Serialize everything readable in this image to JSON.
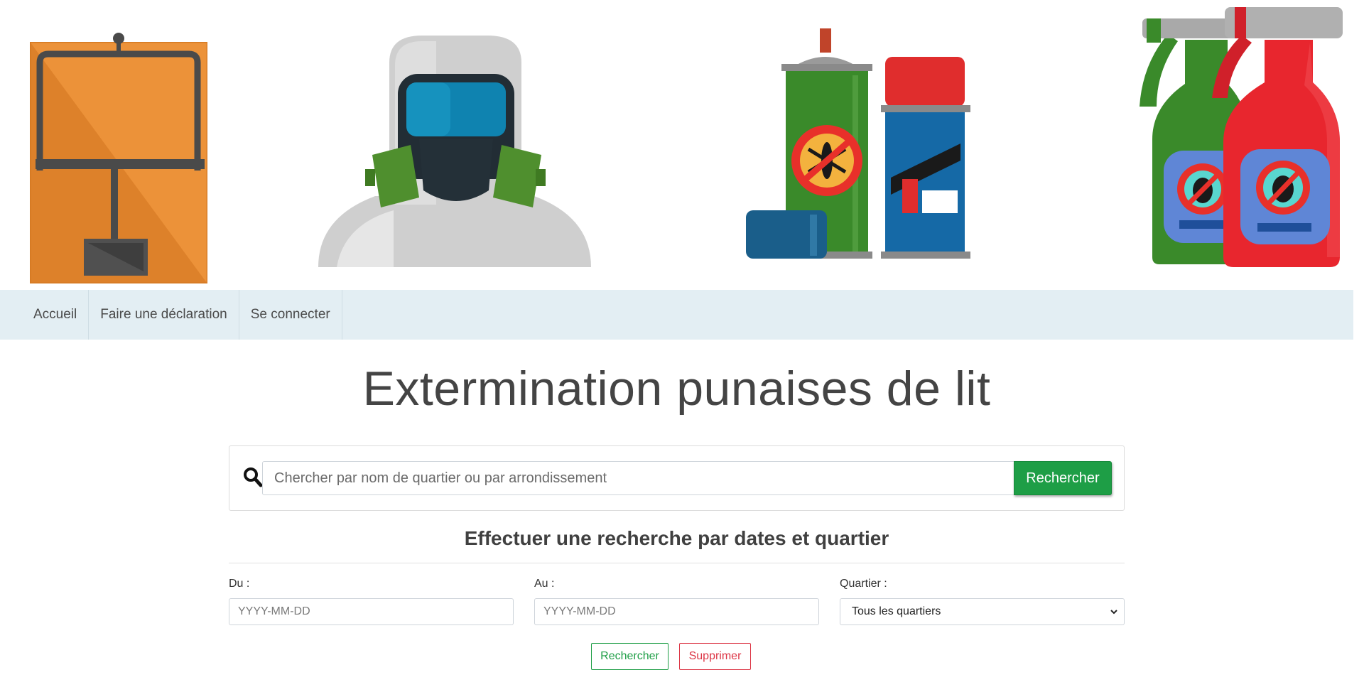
{
  "colors": {
    "nav_background": "#e3eef3",
    "primary_green": "#1e9e46",
    "danger_red": "#dc3545",
    "text_dark": "#444444"
  },
  "banner": {
    "images": [
      "mousetrap-illustration",
      "hazmat-suit-illustration",
      "insecticide-cans-illustration",
      "spray-bottles-illustration"
    ]
  },
  "nav": {
    "items": [
      {
        "label": "Accueil"
      },
      {
        "label": "Faire une déclaration"
      },
      {
        "label": "Se connecter"
      }
    ]
  },
  "page": {
    "title": "Extermination punaises de lit"
  },
  "search": {
    "icon": "search-icon",
    "placeholder": "Chercher par nom de quartier ou par arrondissement",
    "button_label": "Rechercher"
  },
  "date_search": {
    "title": "Effectuer une recherche par dates et quartier",
    "from_label": "Du :",
    "from_placeholder": "YYYY-MM-DD",
    "to_label": "Au :",
    "to_placeholder": "YYYY-MM-DD",
    "district_label": "Quartier :",
    "district_selected": "Tous les quartiers",
    "search_button": "Rechercher",
    "delete_button": "Supprimer"
  }
}
